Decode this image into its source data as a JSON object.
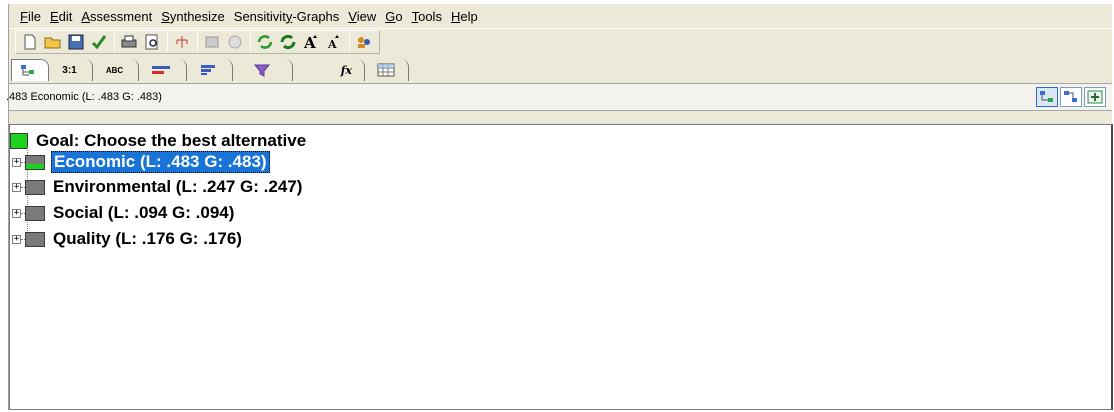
{
  "menu": [
    {
      "pre": "",
      "u": "F",
      "post": "ile"
    },
    {
      "pre": "",
      "u": "E",
      "post": "dit"
    },
    {
      "pre": "",
      "u": "A",
      "post": "ssessment"
    },
    {
      "pre": "",
      "u": "S",
      "post": "ynthesize"
    },
    {
      "pre": "Sensitivit",
      "u": "y",
      "post": "-Graphs"
    },
    {
      "pre": "",
      "u": "V",
      "post": "iew"
    },
    {
      "pre": "",
      "u": "G",
      "post": "o"
    },
    {
      "pre": "",
      "u": "T",
      "post": "ools"
    },
    {
      "pre": "",
      "u": "H",
      "post": "elp"
    }
  ],
  "tabs": [
    "3:1",
    "ABC",
    "fx"
  ],
  "info": {
    "text": ".483 Economic (L: .483 G: .483)"
  },
  "tree": {
    "goal": "Goal: Choose the best alternative",
    "criteria": [
      {
        "label": "Economic (L: .483 G: .483)",
        "selected": true,
        "bar_fraction": 0.483
      },
      {
        "label": "Environmental (L: .247 G: .247)",
        "selected": false,
        "bar_fraction": 0.247
      },
      {
        "label": "Social (L: .094 G: .094)",
        "selected": false,
        "bar_fraction": 0.094
      },
      {
        "label": "Quality (L: .176 G: .176)",
        "selected": false,
        "bar_fraction": 0.176
      }
    ]
  },
  "colors": {
    "accent_green": "#1dd31d",
    "selection_blue": "#1874d6"
  }
}
